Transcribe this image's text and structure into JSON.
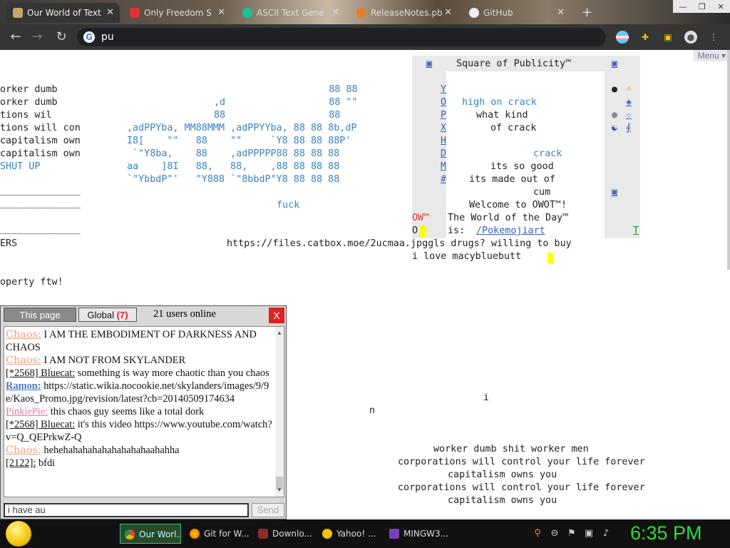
{
  "browser": {
    "tabs": [
      {
        "label": "Our World of Text",
        "active": true
      },
      {
        "label": "Only Freedom S",
        "active": false
      },
      {
        "label": "ASCII Text Gene",
        "active": false
      },
      {
        "label": "ReleaseNotes.pb",
        "active": false
      },
      {
        "label": "GitHub",
        "active": false
      }
    ],
    "new_tab": "+",
    "window_controls": {
      "minimize": "—",
      "maximize": "❐",
      "close": "✕"
    },
    "address": "pu",
    "accent": "#353535"
  },
  "page": {
    "menu_label": "Menu",
    "left_lines": [
      "orker dumb",
      "orker dumb",
      "tions wil",
      "tions will con",
      "capitalism own",
      "capitalism own",
      "SHUT UP",
      "______________",
      "______________",
      "",
      "______________",
      "ERS",
      "",
      "",
      "operty ftw!"
    ],
    "ascii_art": [
      "                    88 88",
      ",d                  88 \"\"",
      "88                  88",
      ",adPPYba, MM88MMM ,adPPYYba, 88 88 8b,dP",
      "I8[    \"\"   88    \"\"     `Y8 88 88 88P'",
      " `\"Y8ba,    88    ,adPPPPP88 88 88 88",
      "aa    ]8I   88,   88,    ,88 88 88 88",
      "`\"YbbdP\"'   \"Y888 `\"8bbdP\"Y8 88 88 88"
    ],
    "fuck_text": "fuck",
    "url_line": "https://files.catbox.moe/2ucmaa.jpggls drugs? willing to buy",
    "macy_line": "i love macybluebutt",
    "scatter_i": "i",
    "scatter_n": "n",
    "bottom_lines": [
      "worker dumb shit worker men",
      "corporations will control your life forever",
      "capitalism owns you",
      "corporations will control your life forever",
      "capitalism owns you"
    ]
  },
  "publicity": {
    "title": "Square of Publicity™",
    "corner_icon": "▣",
    "side_letters": [
      "Y",
      "O",
      "P",
      "X",
      "H",
      "D",
      "M",
      "#"
    ],
    "right_icons": [
      "●",
      "☼",
      "◈",
      "●",
      "☆",
      "☯",
      "∮"
    ],
    "lines": [
      "high on crack",
      "what kind",
      "of crack",
      "",
      "",
      "crack",
      "its so good",
      "its made out of",
      "cum"
    ],
    "welcome": "Welcome to OWOT™!",
    "wotd_label": "The World of the Day™",
    "wotd_is": "is:",
    "wotd_link": "/Pokemojiart",
    "ow_mark": "OW™",
    "o_mark": "O",
    "t_mark": "T"
  },
  "chat": {
    "tab_this_page": "This page",
    "tab_global": "Global",
    "global_count": "(7)",
    "users_online": "21 users online",
    "close": "X",
    "messages": [
      {
        "nick": "Chaos:",
        "style": "chaos",
        "text": "I AM THE EMBODIMENT OF DARKNESS AND CHAOS"
      },
      {
        "nick": "Chaos:",
        "style": "chaos",
        "text": "I AM NOT FROM SKYLANDER"
      },
      {
        "nick": "[*2568] Bluecat:",
        "style": "plain",
        "text": "something is way more chaotic than you chaos"
      },
      {
        "nick": "Ramon:",
        "style": "ramon",
        "text": "https://static.wikia.nocookie.net/skylanders/images/9/9e/Kaos_Promo.jpg/revision/latest?cb=20140509174634"
      },
      {
        "nick": "PinkiePie:",
        "style": "pink",
        "text": "this chaos guy seems like a total dork"
      },
      {
        "nick": "[*2568] Bluecat:",
        "style": "plain",
        "text": "it's this video https://www.youtube.com/watch?v=Q_QEPrkwZ-Q"
      },
      {
        "nick": "Chaos:",
        "style": "chaos",
        "text": "hehehahahahahahahahahaahahha"
      },
      {
        "nick": "[2122]:",
        "style": "plain",
        "text": "bfdi"
      }
    ],
    "input_value": "i have au",
    "send_label": "Send"
  },
  "taskbar": {
    "items": [
      {
        "label": "Our Worl...",
        "active": true,
        "icon": "chrome-icon"
      },
      {
        "label": "Git for W...",
        "active": false,
        "icon": "firefox-icon"
      },
      {
        "label": "Downlo...",
        "active": false,
        "icon": "download-icon"
      },
      {
        "label": "Yahoo! ...",
        "active": false,
        "icon": "yahoo-icon"
      },
      {
        "label": "MINGW3...",
        "active": false,
        "icon": "mingw-icon"
      }
    ],
    "clock": "6:35 PM",
    "clock_color": "#35d83a"
  }
}
